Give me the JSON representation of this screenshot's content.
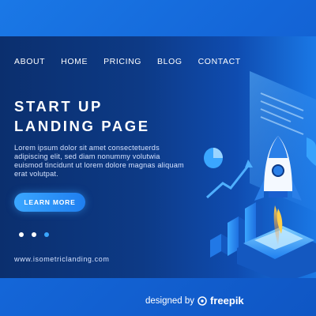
{
  "nav": {
    "items": [
      "ABOUT",
      "HOME",
      "PRICING",
      "BLOG",
      "CONTACT"
    ]
  },
  "hero": {
    "headline_line1": "START UP",
    "headline_line2": "LANDING PAGE",
    "body": "Lorem ipsum dolor sit amet consectetuerds adipiscing elit, sed diam nonummy volutwia euismod tincidunt ut lorem dolore magnas aliquam erat volutpat.",
    "cta_label": "LEARN MORE"
  },
  "carousel": {
    "count": 3,
    "active": 3
  },
  "footer": {
    "website": "www.isometriclanding.com"
  },
  "credit": {
    "prefix": "designed by",
    "brand": "freepik"
  },
  "colors": {
    "accent": "#3aa6ff",
    "card_dark": "#0b2f6e",
    "background": "#1466d8"
  },
  "icons": [
    "rocket-illustration",
    "bar-chart-illustration",
    "trend-arrow-illustration",
    "pie-chart-illustration",
    "freepik-logo-icon"
  ]
}
